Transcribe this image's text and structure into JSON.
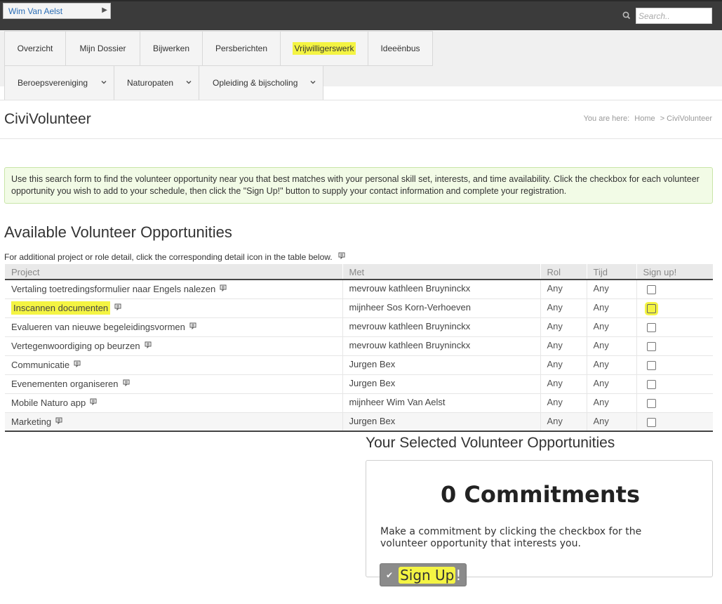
{
  "topbar": {
    "user_name": "Wim Van Aelst",
    "search_placeholder": "Search.."
  },
  "nav": {
    "row1": [
      "Overzicht",
      "Mijn Dossier",
      "Bijwerken",
      "Persberichten",
      "Vrijwilligerswerk",
      "Ideeënbus"
    ],
    "row2": [
      "Beroepsvereniging",
      "Naturopaten",
      "Opleiding & bijscholing"
    ],
    "highlighted": "Vrijwilligerswerk"
  },
  "page": {
    "title": "CiviVolunteer",
    "breadcrumb_prefix": "You are here:",
    "breadcrumb_home": "Home",
    "breadcrumb_current": "> CiviVolunteer"
  },
  "help_text": "Use this search form to find the volunteer opportunity near you that best matches with your personal skill set, interests, and time availability. Click the checkbox for each volunteer opportunity you wish to add to your schedule, then click the \"Sign Up!\" button to supply your contact information and complete your registration.",
  "opportunities": {
    "title": "Available Volunteer Opportunities",
    "detail_note": "For additional project or role detail, click the corresponding detail icon in the table below.",
    "columns": [
      "Project",
      "Met",
      "Rol",
      "Tijd",
      "Sign up!"
    ],
    "rows": [
      {
        "project": "Vertaling toetredingsformulier naar Engels nalezen",
        "met": "mevrouw kathleen Bruyninckx",
        "rol": "Any",
        "tijd": "Any"
      },
      {
        "project": "Inscannen documenten",
        "met": "mijnheer Sos Korn-Verhoeven",
        "rol": "Any",
        "tijd": "Any"
      },
      {
        "project": "Evalueren van nieuwe begeleidingsvormen",
        "met": "mevrouw kathleen Bruyninckx",
        "rol": "Any",
        "tijd": "Any"
      },
      {
        "project": "Vertegenwoordiging op beurzen",
        "met": "mevrouw kathleen Bruyninckx",
        "rol": "Any",
        "tijd": "Any"
      },
      {
        "project": "Communicatie",
        "met": "Jurgen Bex",
        "rol": "Any",
        "tijd": "Any"
      },
      {
        "project": "Evenementen organiseren",
        "met": "Jurgen Bex",
        "rol": "Any",
        "tijd": "Any"
      },
      {
        "project": "Mobile Naturo app",
        "met": "mijnheer Wim Van Aelst",
        "rol": "Any",
        "tijd": "Any"
      },
      {
        "project": "Marketing",
        "met": "Jurgen Bex",
        "rol": "Any",
        "tijd": "Any"
      }
    ]
  },
  "selected": {
    "title": "Your Selected Volunteer Opportunities",
    "commitments": "0 Commitments",
    "note": "Make a commitment by clicking the checkbox for the volunteer opportunity that interests you.",
    "signup_label": "Sign Up",
    "signup_bang": "!"
  },
  "colors": {
    "highlight": "#f4f443",
    "topbar": "#3b3b3b",
    "link": "#2a6db5"
  }
}
